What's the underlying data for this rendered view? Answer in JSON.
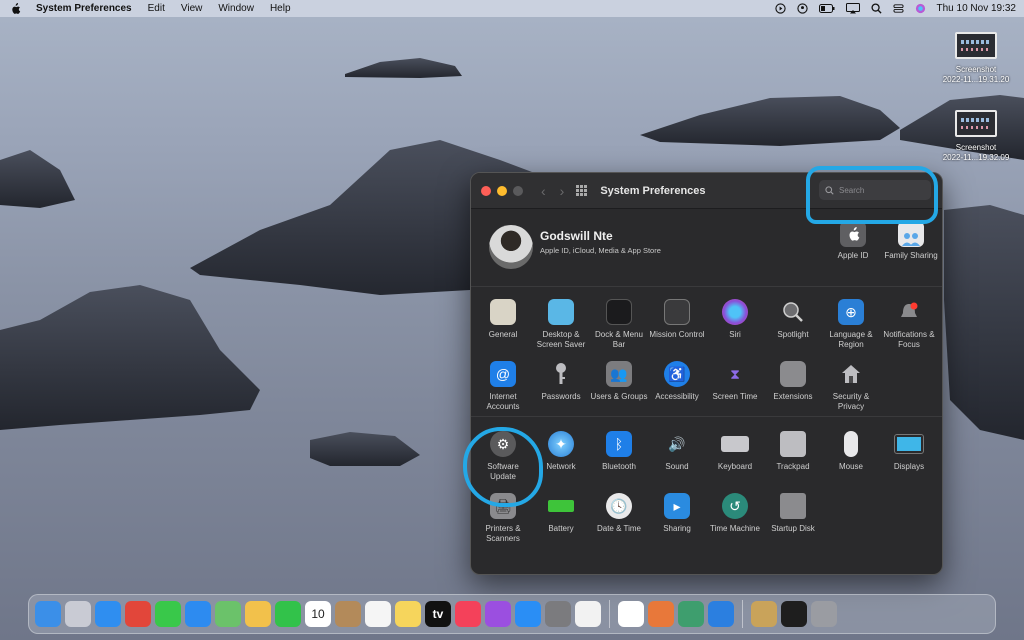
{
  "menubar": {
    "app_name": "System Preferences",
    "menus": [
      "Edit",
      "View",
      "Window",
      "Help"
    ],
    "datetime": "Thu 10 Nov  19:32"
  },
  "desktop": {
    "files": [
      {
        "name_line1": "Screenshot",
        "name_line2": "2022-11...19.31.20"
      },
      {
        "name_line1": "Screenshot",
        "name_line2": "2022-11...19.32.09"
      }
    ]
  },
  "window": {
    "title": "System Preferences",
    "search_placeholder": "Search",
    "user": {
      "name": "Godswill Nte",
      "subtitle": "Apple ID, iCloud, Media & App Store"
    },
    "top_panes": [
      {
        "label": "Apple ID",
        "icon": "apple-icon"
      },
      {
        "label": "Family Sharing",
        "icon": "family-sharing-icon"
      }
    ],
    "section1": [
      {
        "label": "General",
        "icon": "general-icon",
        "color": "#d9d4c6"
      },
      {
        "label": "Desktop & Screen Saver",
        "icon": "desktop-screensaver-icon",
        "color": "#5ab7e6"
      },
      {
        "label": "Dock & Menu Bar",
        "icon": "dock-menubar-icon",
        "color": "#1b1b1d"
      },
      {
        "label": "Mission Control",
        "icon": "mission-control-icon",
        "color": "#3a3a3c"
      },
      {
        "label": "Siri",
        "icon": "siri-icon",
        "color": "#8a4fd8"
      },
      {
        "label": "Spotlight",
        "icon": "spotlight-icon",
        "color": "#6d6d70"
      },
      {
        "label": "Language & Region",
        "icon": "language-region-icon",
        "color": "#2a7fd6"
      },
      {
        "label": "Notifications & Focus",
        "icon": "notifications-icon",
        "color": "#6d6d70"
      },
      {
        "label": "Internet Accounts",
        "icon": "internet-accounts-icon",
        "color": "#1f7fe8"
      },
      {
        "label": "Passwords",
        "icon": "passwords-icon",
        "color": "#5a5a5c"
      },
      {
        "label": "Users & Groups",
        "icon": "users-groups-icon",
        "color": "#7c7c7f"
      },
      {
        "label": "Accessibility",
        "icon": "accessibility-icon",
        "color": "#1f7fe8"
      },
      {
        "label": "Screen Time",
        "icon": "screen-time-icon",
        "color": "#5b3fb8"
      },
      {
        "label": "Extensions",
        "icon": "extensions-icon",
        "color": "#8b8b8e"
      },
      {
        "label": "Security & Privacy",
        "icon": "security-privacy-icon",
        "color": "#6a6a6c"
      }
    ],
    "section2": [
      {
        "label": "Software Update",
        "icon": "software-update-icon",
        "color": "#5a5a5c"
      },
      {
        "label": "Network",
        "icon": "network-icon",
        "color": "#2a7fd6"
      },
      {
        "label": "Bluetooth",
        "icon": "bluetooth-icon",
        "color": "#1f7fe8"
      },
      {
        "label": "Sound",
        "icon": "sound-icon",
        "color": "#7a7a7d"
      },
      {
        "label": "Keyboard",
        "icon": "keyboard-icon",
        "color": "#c8c8cc"
      },
      {
        "label": "Trackpad",
        "icon": "trackpad-icon",
        "color": "#bdbdc1"
      },
      {
        "label": "Mouse",
        "icon": "mouse-icon",
        "color": "#e8e8ea"
      },
      {
        "label": "Displays",
        "icon": "displays-icon",
        "color": "#3fb6e8"
      },
      {
        "label": "Printers & Scanners",
        "icon": "printers-scanners-icon",
        "color": "#8a8a8d"
      },
      {
        "label": "Battery",
        "icon": "battery-icon",
        "color": "#3ec43a"
      },
      {
        "label": "Date & Time",
        "icon": "date-time-icon",
        "color": "#e9e9ea"
      },
      {
        "label": "Sharing",
        "icon": "sharing-icon",
        "color": "#2a8be0"
      },
      {
        "label": "Time Machine",
        "icon": "time-machine-icon",
        "color": "#2b8a7a"
      },
      {
        "label": "Startup Disk",
        "icon": "startup-disk-icon",
        "color": "#8b8b8e"
      }
    ]
  },
  "dock": {
    "apps": [
      {
        "icon": "finder-icon",
        "color": "#3b8fe8",
        "glyph": ""
      },
      {
        "icon": "launchpad-icon",
        "color": "#c9cbd4",
        "glyph": ""
      },
      {
        "icon": "safari-icon",
        "color": "#2f8ef0",
        "glyph": ""
      },
      {
        "icon": "chrome-icon",
        "color": "#e2463a",
        "glyph": ""
      },
      {
        "icon": "messages-icon",
        "color": "#39c84a",
        "glyph": ""
      },
      {
        "icon": "mail-icon",
        "color": "#2d8bf0",
        "glyph": ""
      },
      {
        "icon": "maps-icon",
        "color": "#6bc26a",
        "glyph": ""
      },
      {
        "icon": "photos-icon",
        "color": "#f2c14b",
        "glyph": ""
      },
      {
        "icon": "facetime-icon",
        "color": "#32c24a",
        "glyph": ""
      },
      {
        "icon": "calendar-icon",
        "color": "#ffffff",
        "glyph": "10"
      },
      {
        "icon": "contacts-icon",
        "color": "#b38a5a",
        "glyph": ""
      },
      {
        "icon": "reminders-icon",
        "color": "#f5f5f5",
        "glyph": ""
      },
      {
        "icon": "notes-icon",
        "color": "#f6d55c",
        "glyph": ""
      },
      {
        "icon": "appletv-icon",
        "color": "#111111",
        "glyph": "tv"
      },
      {
        "icon": "music-icon",
        "color": "#f4415a",
        "glyph": ""
      },
      {
        "icon": "podcasts-icon",
        "color": "#9b4fe0",
        "glyph": ""
      },
      {
        "icon": "appstore-icon",
        "color": "#2a8ef5",
        "glyph": ""
      },
      {
        "icon": "system-preferences-icon",
        "color": "#7b7b7e",
        "glyph": ""
      },
      {
        "icon": "accessibility-keyboard-icon",
        "color": "#f2f2f2",
        "glyph": ""
      },
      {
        "icon": "sourcetree-icon",
        "color": "#ffffff",
        "glyph": ""
      },
      {
        "icon": "firefox-icon",
        "color": "#e8783a",
        "glyph": ""
      },
      {
        "icon": "atom-icon",
        "color": "#3e9e6e",
        "glyph": ""
      },
      {
        "icon": "xcode-icon",
        "color": "#2b7fe0",
        "glyph": ""
      },
      {
        "icon": "preview-icon",
        "color": "#c9a35a",
        "glyph": ""
      },
      {
        "icon": "terminal-icon",
        "color": "#1e1e1e",
        "glyph": ""
      },
      {
        "icon": "trash-icon",
        "color": "#9a9ca2",
        "glyph": ""
      }
    ]
  }
}
